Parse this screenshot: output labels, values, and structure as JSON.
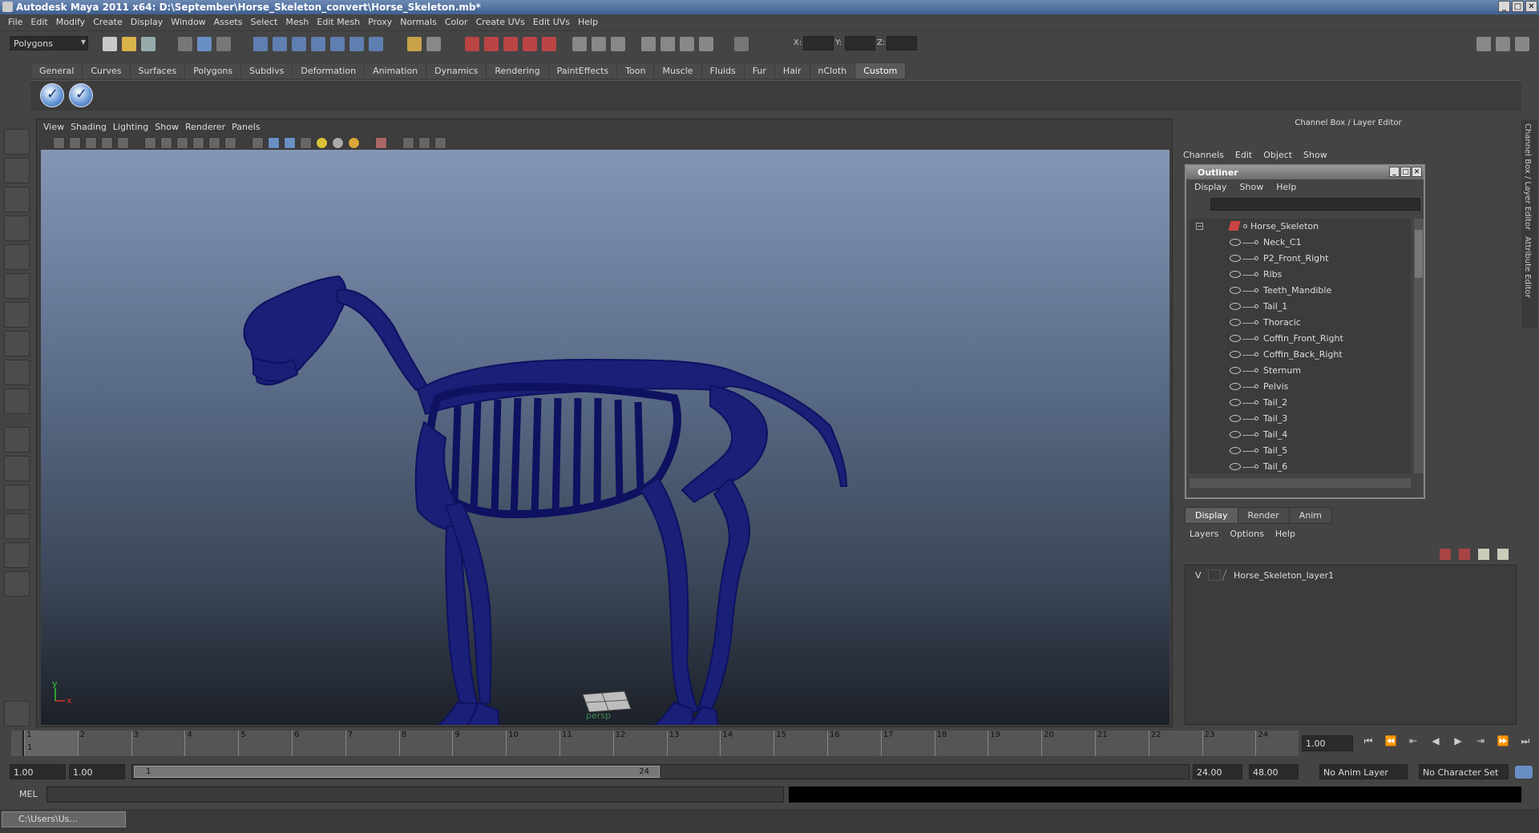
{
  "title": "Autodesk Maya 2011 x64: D:\\September\\Horse_Skeleton_convert\\Horse_Skeleton.mb*",
  "menus": [
    "File",
    "Edit",
    "Modify",
    "Create",
    "Display",
    "Window",
    "Assets",
    "Select",
    "Mesh",
    "Edit Mesh",
    "Proxy",
    "Normals",
    "Color",
    "Create UVs",
    "Edit UVs",
    "Help"
  ],
  "mode_selector": "Polygons",
  "coords": {
    "x": "X:",
    "y": "Y:",
    "z": "Z:"
  },
  "shelf_tabs": [
    "General",
    "Curves",
    "Surfaces",
    "Polygons",
    "Subdivs",
    "Deformation",
    "Animation",
    "Dynamics",
    "Rendering",
    "PaintEffects",
    "Toon",
    "Muscle",
    "Fluids",
    "Fur",
    "Hair",
    "nCloth",
    "Custom"
  ],
  "shelf_active": "Custom",
  "viewport": {
    "menus": [
      "View",
      "Shading",
      "Lighting",
      "Show",
      "Renderer",
      "Panels"
    ],
    "camera": "persp",
    "axis_x": "x",
    "axis_y": "y"
  },
  "channel_box": {
    "title": "Channel Box / Layer Editor",
    "menus": [
      "Channels",
      "Edit",
      "Object",
      "Show"
    ]
  },
  "side_tabs": [
    "Channel Box / Layer Editor",
    "Attribute Editor"
  ],
  "outliner": {
    "title": "Outliner",
    "menus": [
      "Display",
      "Show",
      "Help"
    ],
    "root": "Horse_Skeleton",
    "items": [
      "Neck_C1",
      "P2_Front_Right",
      "Ribs",
      "Teeth_Mandible",
      "Tail_1",
      "Thoracic",
      "Coffin_Front_Right",
      "Coffin_Back_Right",
      "Sternum",
      "Pelvis",
      "Tail_2",
      "Tail_3",
      "Tail_4",
      "Tail_5",
      "Tail_6"
    ]
  },
  "layer_editor": {
    "tabs": [
      "Display",
      "Render",
      "Anim"
    ],
    "active_tab": "Display",
    "menus": [
      "Layers",
      "Options",
      "Help"
    ],
    "layer_visibility": "V",
    "layer_name": "Horse_Skeleton_layer1"
  },
  "timeline": {
    "ticks": [
      "1",
      "2",
      "3",
      "4",
      "5",
      "6",
      "7",
      "8",
      "9",
      "10",
      "11",
      "12",
      "13",
      "14",
      "15",
      "16",
      "17",
      "18",
      "19",
      "20",
      "21",
      "22",
      "23",
      "24"
    ],
    "current_frame": "1.00",
    "playhead_label": "1"
  },
  "range": {
    "start": "1.00",
    "playback_start": "1.00",
    "slider_start": "1",
    "slider_end": "24",
    "playback_end": "24.00",
    "end": "48.00",
    "anim_layer": "No Anim Layer",
    "character_set": "No Character Set"
  },
  "command_line": {
    "label": "MEL"
  },
  "taskbar": {
    "item": "C:\\Users\\Us..."
  }
}
